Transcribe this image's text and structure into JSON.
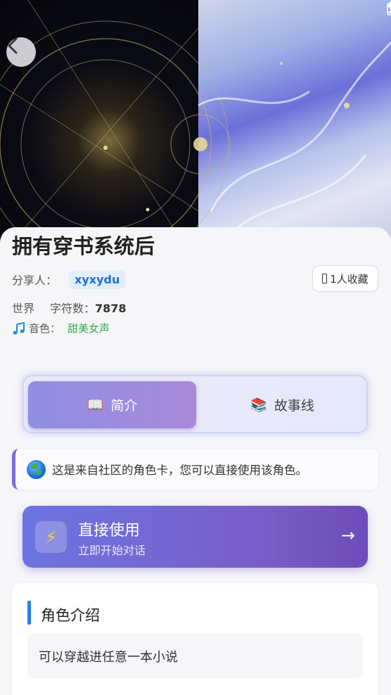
{
  "header": {
    "back_icon": "chevron-left-icon",
    "status_icons": [
      "wifi-icon",
      "signal-icon",
      "battery-icon"
    ]
  },
  "card_info": {
    "title": "拥有穿书系统后",
    "sharer_label": "分享人：",
    "sharer_name": "xyxydu",
    "favorites": "1人收藏",
    "world_label": "世界",
    "char_count_label": "字符数：",
    "char_count": "7878",
    "voice_label": "音色：",
    "voice_value": "甜美女声"
  },
  "tabs": [
    {
      "icon": "📖",
      "label": "简介",
      "active": true
    },
    {
      "icon": "📚",
      "label": "故事线",
      "active": false
    }
  ],
  "notice": {
    "text": "这是来自社区的角色卡，您可以直接使用该角色。"
  },
  "use_button": {
    "icon": "⚡",
    "title": "直接使用",
    "subtitle": "立即开始对话",
    "arrow": "→"
  },
  "intro": {
    "heading": "角色介绍",
    "body": "可以穿越进任意一本小说"
  },
  "colors": {
    "accent_purple": "#7e6be0",
    "link_blue": "#1f6fd6",
    "voice_green": "#35a853",
    "heading_bar": "#2a80e8"
  }
}
